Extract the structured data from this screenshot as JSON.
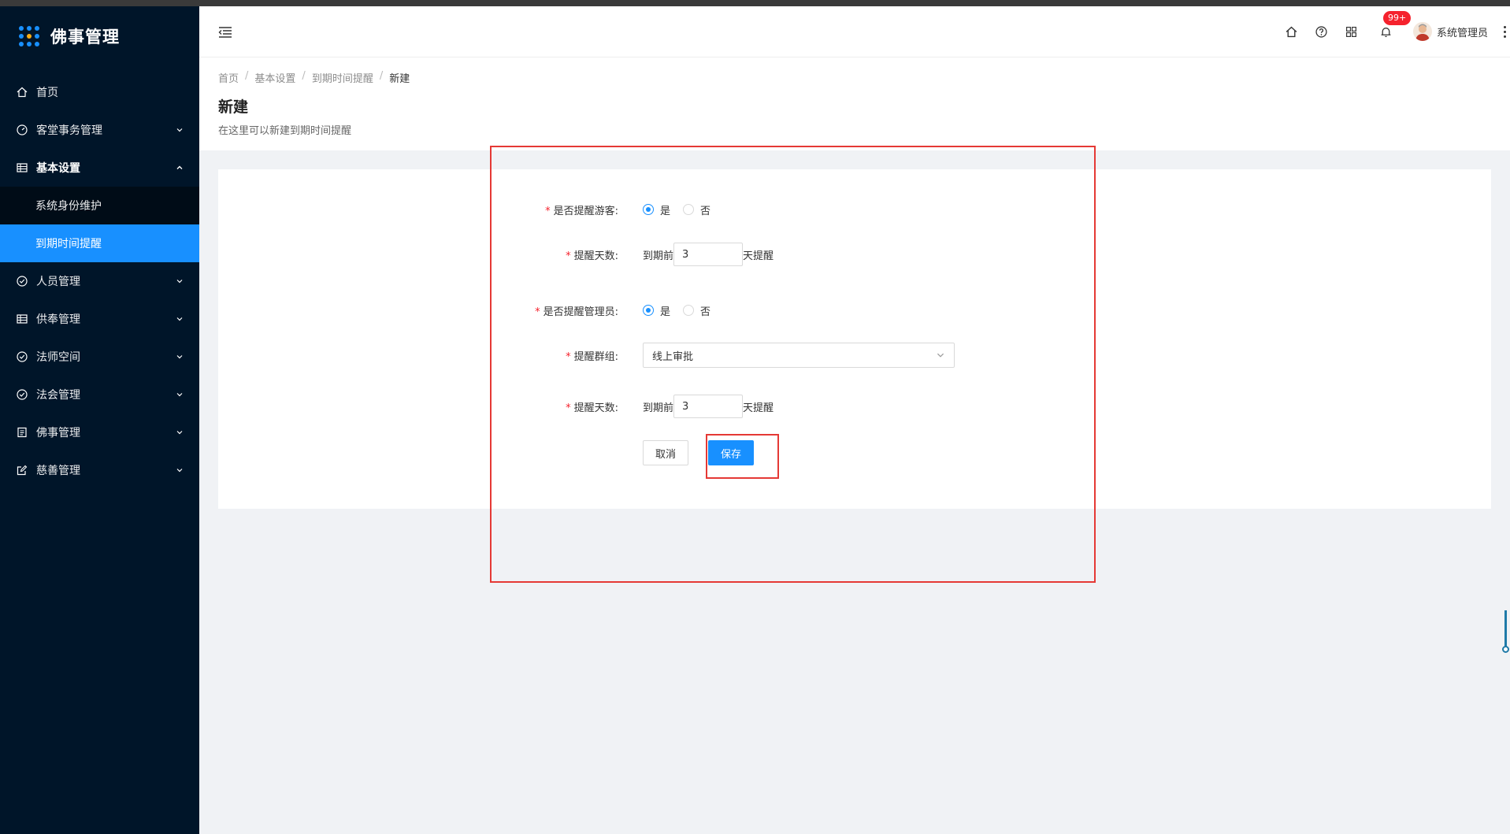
{
  "app": {
    "title": "佛事管理"
  },
  "sidebar": {
    "items": [
      {
        "label": "首页",
        "icon": "home-icon"
      },
      {
        "label": "客堂事务管理",
        "icon": "dashboard-icon"
      },
      {
        "label": "基本设置",
        "icon": "table-icon"
      },
      {
        "label": "人员管理",
        "icon": "check-circle-icon"
      },
      {
        "label": "供奉管理",
        "icon": "table-icon"
      },
      {
        "label": "法师空间",
        "icon": "check-circle-icon"
      },
      {
        "label": "法会管理",
        "icon": "check-circle-icon"
      },
      {
        "label": "佛事管理",
        "icon": "profile-icon"
      },
      {
        "label": "慈善管理",
        "icon": "form-icon"
      }
    ],
    "submenu": [
      {
        "label": "系统身份维护"
      },
      {
        "label": "到期时间提醒",
        "active": true
      }
    ]
  },
  "header": {
    "badge": "99+",
    "username": "系统管理员"
  },
  "breadcrumb": [
    "首页",
    "基本设置",
    "到期时间提醒",
    "新建"
  ],
  "page": {
    "title": "新建",
    "description": "在这里可以新建到期时间提醒"
  },
  "form": {
    "remind_visitor": {
      "label": "是否提醒游客:",
      "options": [
        "是",
        "否"
      ],
      "selected": "是"
    },
    "visitor_days": {
      "label": "提醒天数:",
      "prefix": "到期前",
      "value": "3",
      "suffix": "天提醒"
    },
    "remind_admin": {
      "label": "是否提醒管理员:",
      "options": [
        "是",
        "否"
      ],
      "selected": "是"
    },
    "group": {
      "label": "提醒群组:",
      "value": "线上审批"
    },
    "admin_days": {
      "label": "提醒天数:",
      "prefix": "到期前",
      "value": "3",
      "suffix": "天提醒"
    },
    "cancel_label": "取消",
    "save_label": "保存"
  },
  "colors": {
    "primary": "#1890ff",
    "sidebar": "#001529",
    "highlight": "#e53935"
  }
}
